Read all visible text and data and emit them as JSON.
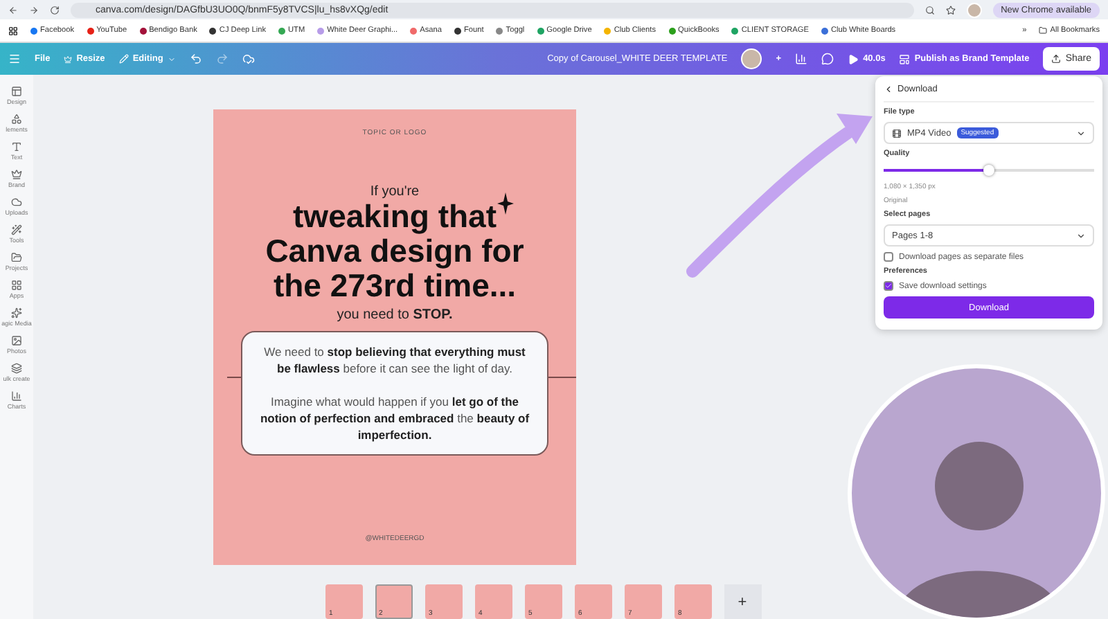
{
  "browser": {
    "url": "canva.com/design/DAGfbU3UO0Q/bnmF5y8TVCS|lu_hs8vXQg/edit",
    "update": "New Chrome available"
  },
  "bookmarks": [
    {
      "label": "Facebook",
      "color": "#1877f2"
    },
    {
      "label": "YouTube",
      "color": "#e62117"
    },
    {
      "label": "Bendigo Bank",
      "color": "#a3123a"
    },
    {
      "label": "CJ Deep Link",
      "color": "#333333"
    },
    {
      "label": "UTM",
      "color": "#34a853"
    },
    {
      "label": "White Deer Graphi...",
      "color": "#b79ce8"
    },
    {
      "label": "Asana",
      "color": "#f06a6a"
    },
    {
      "label": "Fount",
      "color": "#333333"
    },
    {
      "label": "Toggl",
      "color": "#888888"
    },
    {
      "label": "Google Drive",
      "color": "#1fa463"
    },
    {
      "label": "Club Clients",
      "color": "#f4b400"
    },
    {
      "label": "QuickBooks",
      "color": "#2ca01c"
    },
    {
      "label": "CLIENT STORAGE",
      "color": "#1fa463"
    },
    {
      "label": "Club White Boards",
      "color": "#3b6fd8"
    }
  ],
  "bookmarks_more": "»",
  "all_bookmarks": "All Bookmarks",
  "toolbar": {
    "file": "File",
    "resize": "Resize",
    "editing": "Editing",
    "title": "Copy of Carousel_WHITE DEER TEMPLATE",
    "plus": "+",
    "timer": "40.0s",
    "publish": "Publish as Brand Template",
    "share": "Share"
  },
  "sidebar": [
    "Design",
    "lements",
    "Text",
    "Brand",
    "Uploads",
    "Tools",
    "Projects",
    "Apps",
    "agic Media",
    "Photos",
    "ulk create",
    "Charts"
  ],
  "page": {
    "topic": "TOPIC OR LOGO",
    "intro": "If you're",
    "headline": [
      "tweaking that",
      "Canva design for",
      "the 273rd time..."
    ],
    "stop": "you need to **STOP.**",
    "paragraphs": [
      "We need to **stop believing that everything must be flawless** before it can see the light of day.",
      "Imagine what would happen if you **let go of the notion of perfection and embraced** the **beauty of imperfection.**"
    ],
    "handle": "@WHITEDEERGD"
  },
  "thumbnails": [
    {
      "number": "1",
      "selected": false
    },
    {
      "number": "2",
      "selected": true
    },
    {
      "number": "3",
      "selected": false
    },
    {
      "number": "4",
      "selected": false
    },
    {
      "number": "5",
      "selected": false
    },
    {
      "number": "6",
      "selected": false
    },
    {
      "number": "7",
      "selected": false
    },
    {
      "number": "8",
      "selected": false
    }
  ],
  "add_page": "+",
  "download": {
    "title": "Download",
    "file_type_label": "File type",
    "file_type": "MP4 Video",
    "badge": "Suggested",
    "quality_label": "Quality",
    "quality": {
      "level": 0.5
    },
    "size": "1,080 × 1,350 px",
    "size_note": "Original",
    "pages_label": "Select pages",
    "pages": "Pages 1-8",
    "options": [
      {
        "label": "Download pages as separate files",
        "checked": false
      }
    ],
    "preferences_label": "Preferences",
    "preferences": [
      {
        "label": "Save download settings",
        "checked": true
      }
    ],
    "button": "Download"
  }
}
